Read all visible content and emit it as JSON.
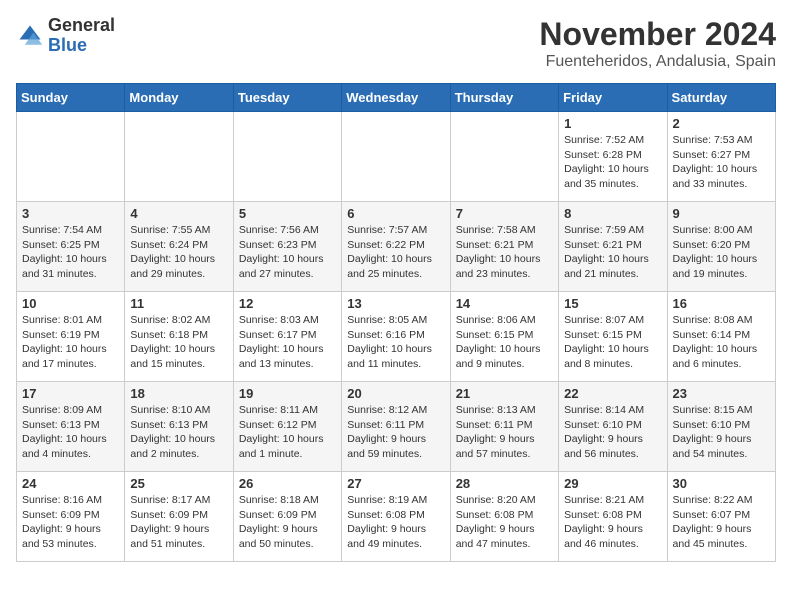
{
  "logo": {
    "general": "General",
    "blue": "Blue"
  },
  "title": "November 2024",
  "location": "Fuenteheridos, Andalusia, Spain",
  "days_of_week": [
    "Sunday",
    "Monday",
    "Tuesday",
    "Wednesday",
    "Thursday",
    "Friday",
    "Saturday"
  ],
  "weeks": [
    [
      {
        "day": "",
        "info": ""
      },
      {
        "day": "",
        "info": ""
      },
      {
        "day": "",
        "info": ""
      },
      {
        "day": "",
        "info": ""
      },
      {
        "day": "",
        "info": ""
      },
      {
        "day": "1",
        "info": "Sunrise: 7:52 AM\nSunset: 6:28 PM\nDaylight: 10 hours and 35 minutes."
      },
      {
        "day": "2",
        "info": "Sunrise: 7:53 AM\nSunset: 6:27 PM\nDaylight: 10 hours and 33 minutes."
      }
    ],
    [
      {
        "day": "3",
        "info": "Sunrise: 7:54 AM\nSunset: 6:25 PM\nDaylight: 10 hours and 31 minutes."
      },
      {
        "day": "4",
        "info": "Sunrise: 7:55 AM\nSunset: 6:24 PM\nDaylight: 10 hours and 29 minutes."
      },
      {
        "day": "5",
        "info": "Sunrise: 7:56 AM\nSunset: 6:23 PM\nDaylight: 10 hours and 27 minutes."
      },
      {
        "day": "6",
        "info": "Sunrise: 7:57 AM\nSunset: 6:22 PM\nDaylight: 10 hours and 25 minutes."
      },
      {
        "day": "7",
        "info": "Sunrise: 7:58 AM\nSunset: 6:21 PM\nDaylight: 10 hours and 23 minutes."
      },
      {
        "day": "8",
        "info": "Sunrise: 7:59 AM\nSunset: 6:21 PM\nDaylight: 10 hours and 21 minutes."
      },
      {
        "day": "9",
        "info": "Sunrise: 8:00 AM\nSunset: 6:20 PM\nDaylight: 10 hours and 19 minutes."
      }
    ],
    [
      {
        "day": "10",
        "info": "Sunrise: 8:01 AM\nSunset: 6:19 PM\nDaylight: 10 hours and 17 minutes."
      },
      {
        "day": "11",
        "info": "Sunrise: 8:02 AM\nSunset: 6:18 PM\nDaylight: 10 hours and 15 minutes."
      },
      {
        "day": "12",
        "info": "Sunrise: 8:03 AM\nSunset: 6:17 PM\nDaylight: 10 hours and 13 minutes."
      },
      {
        "day": "13",
        "info": "Sunrise: 8:05 AM\nSunset: 6:16 PM\nDaylight: 10 hours and 11 minutes."
      },
      {
        "day": "14",
        "info": "Sunrise: 8:06 AM\nSunset: 6:15 PM\nDaylight: 10 hours and 9 minutes."
      },
      {
        "day": "15",
        "info": "Sunrise: 8:07 AM\nSunset: 6:15 PM\nDaylight: 10 hours and 8 minutes."
      },
      {
        "day": "16",
        "info": "Sunrise: 8:08 AM\nSunset: 6:14 PM\nDaylight: 10 hours and 6 minutes."
      }
    ],
    [
      {
        "day": "17",
        "info": "Sunrise: 8:09 AM\nSunset: 6:13 PM\nDaylight: 10 hours and 4 minutes."
      },
      {
        "day": "18",
        "info": "Sunrise: 8:10 AM\nSunset: 6:13 PM\nDaylight: 10 hours and 2 minutes."
      },
      {
        "day": "19",
        "info": "Sunrise: 8:11 AM\nSunset: 6:12 PM\nDaylight: 10 hours and 1 minute."
      },
      {
        "day": "20",
        "info": "Sunrise: 8:12 AM\nSunset: 6:11 PM\nDaylight: 9 hours and 59 minutes."
      },
      {
        "day": "21",
        "info": "Sunrise: 8:13 AM\nSunset: 6:11 PM\nDaylight: 9 hours and 57 minutes."
      },
      {
        "day": "22",
        "info": "Sunrise: 8:14 AM\nSunset: 6:10 PM\nDaylight: 9 hours and 56 minutes."
      },
      {
        "day": "23",
        "info": "Sunrise: 8:15 AM\nSunset: 6:10 PM\nDaylight: 9 hours and 54 minutes."
      }
    ],
    [
      {
        "day": "24",
        "info": "Sunrise: 8:16 AM\nSunset: 6:09 PM\nDaylight: 9 hours and 53 minutes."
      },
      {
        "day": "25",
        "info": "Sunrise: 8:17 AM\nSunset: 6:09 PM\nDaylight: 9 hours and 51 minutes."
      },
      {
        "day": "26",
        "info": "Sunrise: 8:18 AM\nSunset: 6:09 PM\nDaylight: 9 hours and 50 minutes."
      },
      {
        "day": "27",
        "info": "Sunrise: 8:19 AM\nSunset: 6:08 PM\nDaylight: 9 hours and 49 minutes."
      },
      {
        "day": "28",
        "info": "Sunrise: 8:20 AM\nSunset: 6:08 PM\nDaylight: 9 hours and 47 minutes."
      },
      {
        "day": "29",
        "info": "Sunrise: 8:21 AM\nSunset: 6:08 PM\nDaylight: 9 hours and 46 minutes."
      },
      {
        "day": "30",
        "info": "Sunrise: 8:22 AM\nSunset: 6:07 PM\nDaylight: 9 hours and 45 minutes."
      }
    ]
  ]
}
